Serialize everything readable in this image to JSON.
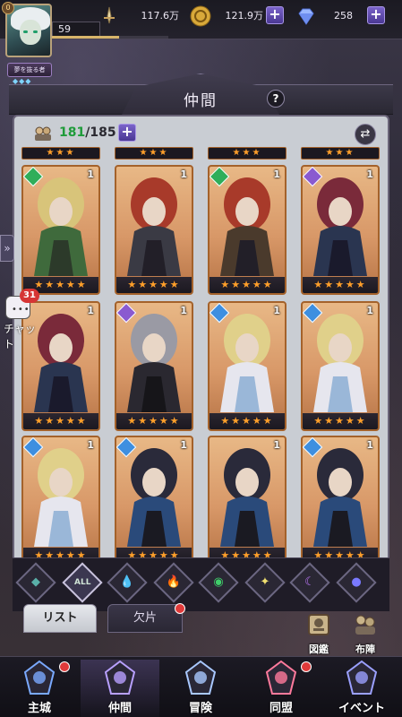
{
  "topbar": {
    "level": "59",
    "vip": "0",
    "title_tag": "夢を抜る者",
    "title_dots": "◆◆◆",
    "xp_fraction": 0.58,
    "power": "117.6万",
    "gold": "121.9万",
    "gems": "258",
    "plus": "+"
  },
  "header": {
    "title": "仲間",
    "help": "?"
  },
  "roster": {
    "current": "181",
    "max": "/185",
    "plus": "+",
    "swap": "⇄"
  },
  "cards": [
    {
      "count": "1",
      "element": "wind",
      "stars": "★★★★★"
    },
    {
      "count": "1",
      "element": "none",
      "stars": "★★★★★"
    },
    {
      "count": "1",
      "element": "wind",
      "stars": "★★★★★"
    },
    {
      "count": "1",
      "element": "arcane",
      "stars": "★★★★★"
    },
    {
      "count": "1",
      "element": "none",
      "stars": "★★★★★"
    },
    {
      "count": "1",
      "element": "arcane",
      "stars": "★★★★★"
    },
    {
      "count": "1",
      "element": "water",
      "stars": "★★★★★"
    },
    {
      "count": "1",
      "element": "water",
      "stars": "★★★★★"
    },
    {
      "count": "1",
      "element": "water",
      "stars": "★★★★★"
    },
    {
      "count": "1",
      "element": "water",
      "stars": "★★★★★"
    },
    {
      "count": "1",
      "element": "none",
      "stars": "★★★★★"
    },
    {
      "count": "1",
      "element": "water",
      "stars": "★★★★★"
    }
  ],
  "partial_stars": "★★★",
  "side": {
    "expand": "»"
  },
  "chat": {
    "badge": "31",
    "label": "チャット"
  },
  "filters": [
    {
      "name": "earth",
      "sym": "◆",
      "color": "#5ab0a8"
    },
    {
      "name": "all",
      "sym": "ALL",
      "color": "#cfe3d6"
    },
    {
      "name": "water",
      "sym": "💧",
      "color": "#5fa8ff"
    },
    {
      "name": "fire",
      "sym": "🔥",
      "color": "#ff6a3a"
    },
    {
      "name": "wind",
      "sym": "◉",
      "color": "#3fcf6a"
    },
    {
      "name": "light",
      "sym": "✦",
      "color": "#f0e070"
    },
    {
      "name": "arcane",
      "sym": "☾",
      "color": "#c07aff"
    },
    {
      "name": "dark",
      "sym": "●",
      "color": "#7a7aff"
    }
  ],
  "tabs": {
    "list": "リスト",
    "fragments": "欠片"
  },
  "side_buttons": {
    "codex": "図鑑",
    "formation": "布陣"
  },
  "nav": [
    {
      "label": "主城",
      "color": "#7aa9ff"
    },
    {
      "label": "仲間",
      "color": "#b8a0ff"
    },
    {
      "label": "冒険",
      "color": "#a9c8ff"
    },
    {
      "label": "同盟",
      "color": "#ff7a9c"
    },
    {
      "label": "イベント",
      "color": "#9ba0ff"
    }
  ],
  "colors": {
    "accent": "#7a63c9",
    "star": "#ff9f2a",
    "count_green": "#1f9b3a",
    "badge": "#d63535"
  }
}
